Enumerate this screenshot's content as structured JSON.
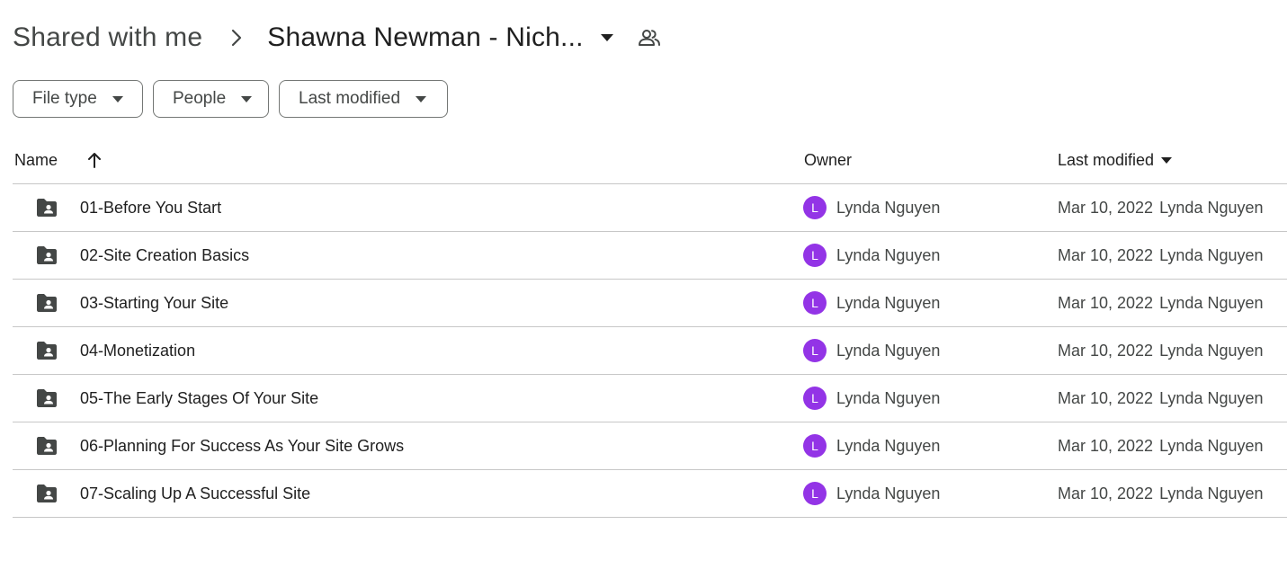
{
  "breadcrumb": {
    "root": "Shared with me",
    "current": "Shawna Newman - Nich..."
  },
  "filters": {
    "file_type": "File type",
    "people": "People",
    "last_modified": "Last modified"
  },
  "table": {
    "headers": {
      "name": "Name",
      "owner": "Owner",
      "last_modified": "Last modified"
    },
    "rows": [
      {
        "name": "01-Before You Start",
        "owner_initial": "L",
        "owner": "Lynda Nguyen",
        "modified_date": "Mar 10, 2022",
        "modified_by": "Lynda Nguyen"
      },
      {
        "name": "02-Site Creation Basics",
        "owner_initial": "L",
        "owner": "Lynda Nguyen",
        "modified_date": "Mar 10, 2022",
        "modified_by": "Lynda Nguyen"
      },
      {
        "name": "03-Starting Your Site",
        "owner_initial": "L",
        "owner": "Lynda Nguyen",
        "modified_date": "Mar 10, 2022",
        "modified_by": "Lynda Nguyen"
      },
      {
        "name": "04-Monetization",
        "owner_initial": "L",
        "owner": "Lynda Nguyen",
        "modified_date": "Mar 10, 2022",
        "modified_by": "Lynda Nguyen"
      },
      {
        "name": "05-The Early Stages Of Your Site",
        "owner_initial": "L",
        "owner": "Lynda Nguyen",
        "modified_date": "Mar 10, 2022",
        "modified_by": "Lynda Nguyen"
      },
      {
        "name": "06-Planning For Success As Your Site Grows",
        "owner_initial": "L",
        "owner": "Lynda Nguyen",
        "modified_date": "Mar 10, 2022",
        "modified_by": "Lynda Nguyen"
      },
      {
        "name": "07-Scaling Up A Successful Site",
        "owner_initial": "L",
        "owner": "Lynda Nguyen",
        "modified_date": "Mar 10, 2022",
        "modified_by": "Lynda Nguyen"
      }
    ]
  },
  "icons": {
    "breadcrumb_separator": "chevron-right-icon",
    "folder_dropdown": "caret-down-icon",
    "shared": "people-icon",
    "sort": "arrow-up-icon",
    "row": "shared-folder-icon"
  },
  "colors": {
    "avatar": "#9334e6",
    "text_primary": "#1f1f1f",
    "text_secondary": "#444746",
    "divider": "#c7c7c7"
  }
}
